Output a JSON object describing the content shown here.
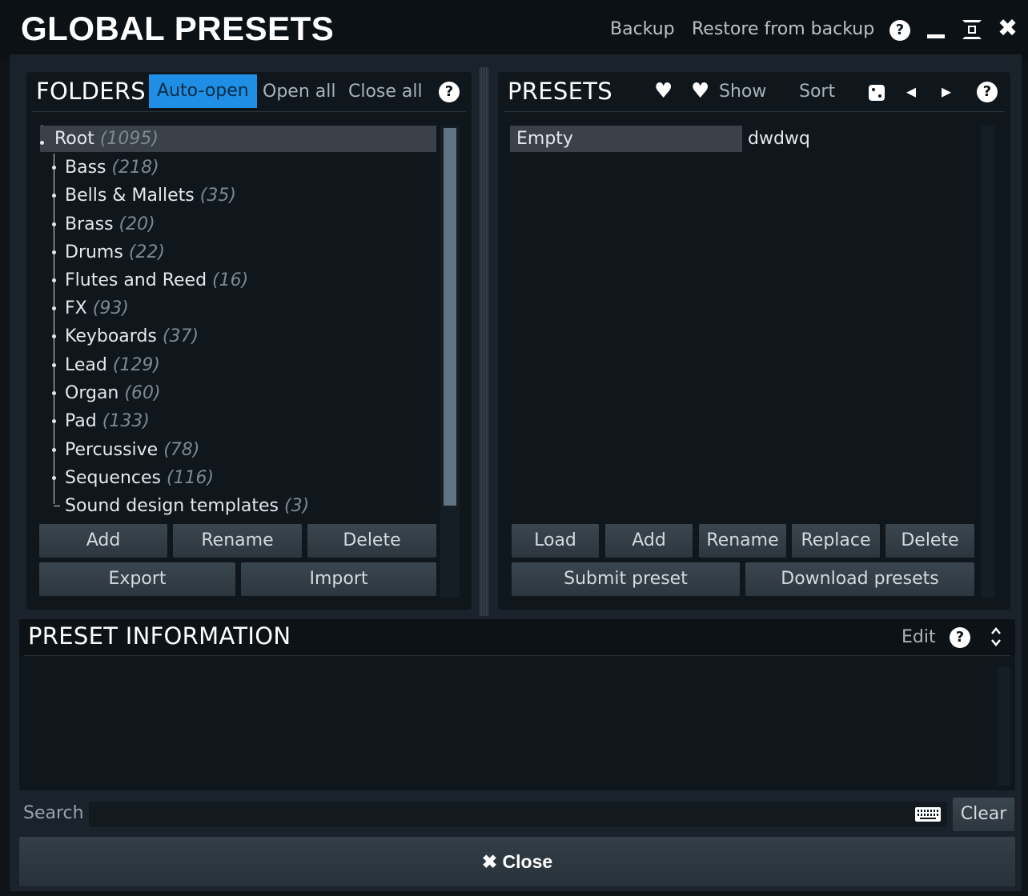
{
  "window": {
    "title": "GLOBAL PRESETS",
    "backup_label": "Backup",
    "restore_label": "Restore from backup",
    "help_glyph": "?",
    "minimize_glyph": "▁",
    "fullscreen_glyph": "⊡",
    "close_glyph": "✖"
  },
  "folders": {
    "title": "FOLDERS",
    "auto_open_label": "Auto-open",
    "open_all_label": "Open all",
    "close_all_label": "Close all",
    "help_glyph": "?",
    "items": [
      {
        "name": "Root",
        "count": "(1095)"
      },
      {
        "name": "Bass",
        "count": "(218)"
      },
      {
        "name": "Bells & Mallets",
        "count": "(35)"
      },
      {
        "name": "Brass",
        "count": "(20)"
      },
      {
        "name": "Drums",
        "count": "(22)"
      },
      {
        "name": "Flutes and Reed",
        "count": "(16)"
      },
      {
        "name": "FX",
        "count": "(93)"
      },
      {
        "name": "Keyboards",
        "count": "(37)"
      },
      {
        "name": "Lead",
        "count": "(129)"
      },
      {
        "name": "Organ",
        "count": "(60)"
      },
      {
        "name": "Pad",
        "count": "(133)"
      },
      {
        "name": "Percussive",
        "count": "(78)"
      },
      {
        "name": "Sequences",
        "count": "(116)"
      },
      {
        "name": "Sound design templates",
        "count": "(3)"
      }
    ],
    "buttons": {
      "add": "Add",
      "rename": "Rename",
      "delete": "Delete",
      "export": "Export",
      "import": "Import"
    }
  },
  "presets": {
    "title": "PRESETS",
    "heart_glyph": "♥",
    "show_label": "Show",
    "sort_label": "Sort",
    "random_glyph": "⚄",
    "prev_glyph": "◂",
    "next_glyph": "▸",
    "help_glyph": "?",
    "items": [
      {
        "name": "Empty",
        "tag": "dwdwq"
      }
    ],
    "buttons": {
      "load": "Load",
      "add": "Add",
      "rename": "Rename",
      "replace": "Replace",
      "delete": "Delete",
      "submit": "Submit preset",
      "download": "Download presets"
    }
  },
  "preset_info": {
    "title": "PRESET INFORMATION",
    "edit_label": "Edit",
    "help_glyph": "?",
    "expand_glyph": "⌃⌄"
  },
  "search": {
    "label": "Search",
    "value": "",
    "keyboard_glyph": "⌨",
    "clear_label": "Clear"
  },
  "footer": {
    "close_glyph": "✖",
    "close_label": "Close"
  },
  "colors": {
    "accent": "#1e8fe4",
    "background": "#0e1317",
    "panel": "#0f161c",
    "selected_row": "#3a4148"
  }
}
